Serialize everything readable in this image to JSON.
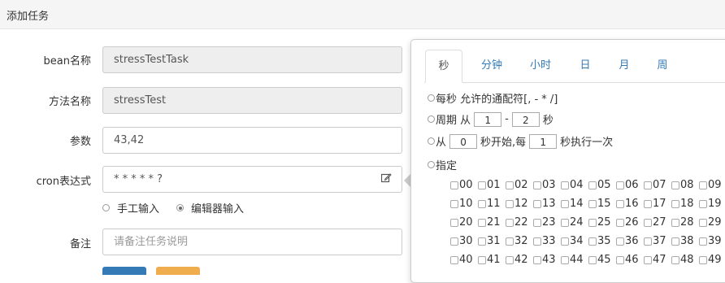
{
  "dialog": {
    "title": "添加任务"
  },
  "form": {
    "bean_label": "bean名称",
    "bean_value": "stressTestTask",
    "method_label": "方法名称",
    "method_value": "stressTest",
    "params_label": "参数",
    "params_value": "43,42",
    "cron_label": "cron表达式",
    "cron_value": "* * * * * ?",
    "input_mode_manual": "手工输入",
    "input_mode_editor": "编辑器输入",
    "remark_label": "备注",
    "remark_placeholder": "请备注任务说明"
  },
  "colors": {
    "primary_button": "#337ab7",
    "warning_button": "#f0ad4e"
  },
  "cron_editor": {
    "tabs": [
      "秒",
      "分钟",
      "小时",
      "日",
      "月",
      "周"
    ],
    "active_tab": "秒",
    "every_label": "每秒 允许的通配符[, - * /]",
    "period_label": "周期 从",
    "period_from": "1",
    "period_dash": "-",
    "period_to": "2",
    "period_unit": "秒",
    "from_label": "从",
    "from_start": "0",
    "from_mid": "秒开始,每",
    "from_every": "1",
    "from_end": "秒执行一次",
    "specify_label": "指定",
    "seconds": [
      "00",
      "01",
      "02",
      "03",
      "04",
      "05",
      "06",
      "07",
      "08",
      "09",
      "10",
      "11",
      "12",
      "13",
      "14",
      "15",
      "16",
      "17",
      "18",
      "19",
      "20",
      "21",
      "22",
      "23",
      "24",
      "25",
      "26",
      "27",
      "28",
      "29",
      "30",
      "31",
      "32",
      "33",
      "34",
      "35",
      "36",
      "37",
      "38",
      "39",
      "40",
      "41",
      "42",
      "43",
      "44",
      "45",
      "46",
      "47",
      "48",
      "49"
    ]
  }
}
